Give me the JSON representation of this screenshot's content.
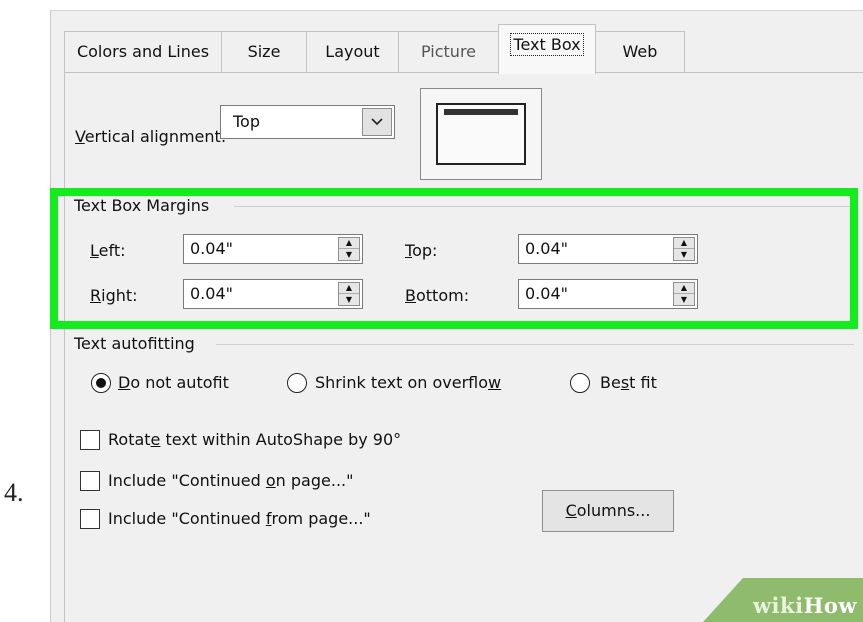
{
  "step_number": "4.",
  "tabs": [
    {
      "label": "Colors and Lines"
    },
    {
      "label": "Size"
    },
    {
      "label": "Layout"
    },
    {
      "label": "Picture"
    },
    {
      "label": "Text Box"
    },
    {
      "label": "Web"
    }
  ],
  "vertical_alignment": {
    "label_rest": "ertical alignment:",
    "label_mnemonic": "V",
    "value": "Top"
  },
  "margins": {
    "group_label": "Text Box Margins",
    "left": {
      "mnemonic": "L",
      "label_rest": "eft:",
      "value": "0.04\""
    },
    "right": {
      "mnemonic": "R",
      "label_rest": "ight:",
      "value": "0.04\""
    },
    "top": {
      "mnemonic": "T",
      "label_rest": "op:",
      "value": "0.04\""
    },
    "bottom": {
      "mnemonic": "B",
      "label_rest": "ottom:",
      "value": "0.04\""
    }
  },
  "autofit": {
    "group_label": "Text autofitting",
    "options": [
      {
        "mnemonic": "D",
        "label_rest": "o not autofit",
        "checked": true
      },
      {
        "label_pre": "Shrink text on overflo",
        "mnemonic": "w",
        "checked": false
      },
      {
        "label_pre": "Be",
        "mnemonic": "s",
        "label_post": "t fit",
        "checked": false
      }
    ]
  },
  "checkboxes": [
    {
      "label_pre": "Rotat",
      "mnemonic": "e",
      "label_post": " text within AutoShape by 90°",
      "checked": false
    },
    {
      "label_pre": "Include \"Continued ",
      "mnemonic": "o",
      "label_post": "n page...\"",
      "checked": false
    },
    {
      "label_pre": "Include \"Continued ",
      "mnemonic": "f",
      "label_post": "rom page...\"",
      "checked": false
    }
  ],
  "columns_button": {
    "mnemonic": "C",
    "label_rest": "olumns..."
  },
  "watermark": {
    "part1": "wiki",
    "part2": "How"
  },
  "colors": {
    "highlight": "#13ed1e",
    "dialog_bg": "#f0f0f0",
    "watermark_bg": "#8fbb6c"
  },
  "icons": {
    "combo": "chevron-down-icon",
    "spinner": "up-down-arrows-icon",
    "radio": "radio-icon",
    "checkbox": "checkbox-icon"
  }
}
